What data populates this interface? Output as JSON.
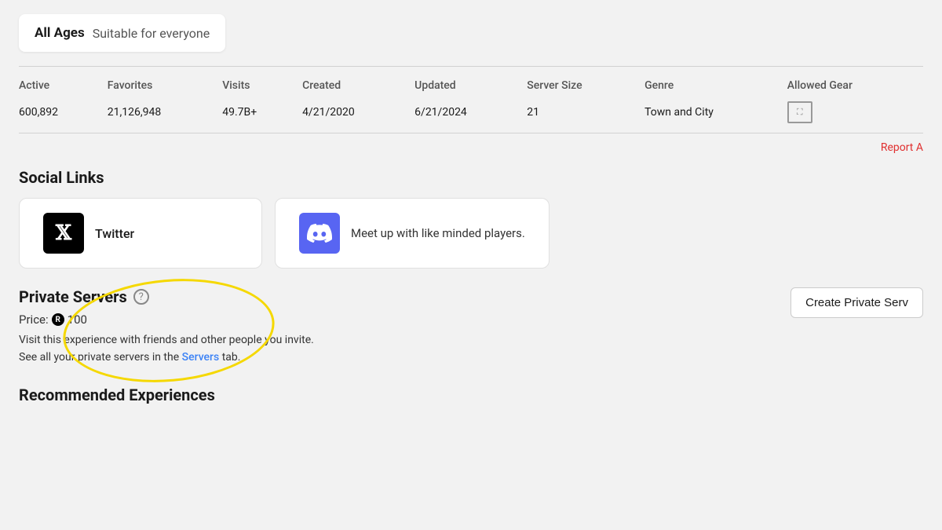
{
  "age_rating": {
    "label": "All Ages",
    "description": "Suitable for everyone"
  },
  "stats": {
    "headers": [
      "Active",
      "Favorites",
      "Visits",
      "Created",
      "Updated",
      "Server Size",
      "Genre",
      "Allowed Gear"
    ],
    "values": [
      "600,892",
      "21,126,948",
      "49.7B+",
      "4/21/2020",
      "6/21/2024",
      "21",
      "Town and City",
      ""
    ]
  },
  "report_link": "Report A",
  "social_links": {
    "title": "Social Links",
    "twitter": {
      "icon_label": "X",
      "label": "Twitter"
    },
    "discord": {
      "label": "Meet up with like minded players."
    }
  },
  "private_servers": {
    "title": "Private Servers",
    "price_label": "Price:",
    "price_amount": "100",
    "description_line1": "Visit this experience with friends and other people you invite.",
    "description_line2": "See all your private servers in the",
    "servers_tab_text": "Servers",
    "description_line3": "tab.",
    "create_button_label": "Create Private Serv"
  },
  "recommended": {
    "title": "Recommended Experiences"
  }
}
